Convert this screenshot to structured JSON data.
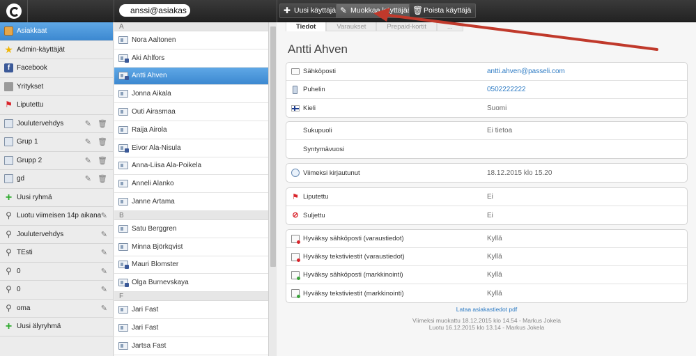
{
  "topbar": {
    "user": "anssi@asiakas",
    "buttons": [
      {
        "label": "Uusi käyttäjä",
        "icon": "plus-icon"
      },
      {
        "label": "Muokkaa käyttäjää",
        "icon": "pencil-icon"
      },
      {
        "label": "Poista käyttäjä",
        "icon": "trash-icon"
      }
    ]
  },
  "sidebar": {
    "items": [
      {
        "label": "Asiakkaat",
        "icon": "address-book-icon"
      },
      {
        "label": "Admin-käyttäjät",
        "icon": "star-icon"
      },
      {
        "label": "Facebook",
        "icon": "facebook-icon"
      },
      {
        "label": "Yritykset",
        "icon": "building-icon"
      },
      {
        "label": "Liputettu",
        "icon": "flag-icon"
      },
      {
        "label": "Joulutervehdys",
        "icon": "group-icon"
      },
      {
        "label": "Grup 1",
        "icon": "group-icon"
      },
      {
        "label": "Grupp 2",
        "icon": "group-icon"
      },
      {
        "label": "gd",
        "icon": "group-icon"
      },
      {
        "label": "Uusi ryhmä",
        "icon": "plus-icon"
      },
      {
        "label": "Luotu viimeisen 14p aikana",
        "icon": "search-icon"
      },
      {
        "label": "Joulutervehdys",
        "icon": "search-icon"
      },
      {
        "label": "TEsti",
        "icon": "search-icon"
      },
      {
        "label": "0",
        "icon": "search-icon"
      },
      {
        "label": "0",
        "icon": "search-icon"
      },
      {
        "label": "oma",
        "icon": "search-icon"
      },
      {
        "label": "Uusi älyryhmä",
        "icon": "plus-icon"
      }
    ]
  },
  "list": {
    "groups": [
      {
        "letter": "A",
        "names": [
          "Nora Aaltonen",
          "Aki Ahlfors",
          "Antti Ahven",
          "Jonna Aikala",
          "Outi Airasmaa",
          "Raija Airola",
          "Eivor Ala-Nisula",
          "Anna-Liisa Ala-Poikela",
          "Anneli Alanko",
          "Janne Artama"
        ]
      },
      {
        "letter": "B",
        "names": [
          "Satu Berggren",
          "Minna Björkqvist",
          "Mauri Blomster",
          "Olga Burnevskaya"
        ]
      },
      {
        "letter": "F",
        "names": [
          "Jari Fast",
          "Jari Fast",
          "Jartsa Fast"
        ]
      }
    ]
  },
  "detail": {
    "tabs": [
      "Tiedot",
      "Varaukset",
      "Prepaid-kortit",
      "..."
    ],
    "name": "Antti Ahven",
    "contact": [
      {
        "label": "Sähköposti",
        "value": "antti.ahven@passeli.com"
      },
      {
        "label": "Puhelin",
        "value": "0502222222"
      },
      {
        "label": "Kieli",
        "value": "Suomi"
      }
    ],
    "personal": [
      {
        "label": "Sukupuoli",
        "value": "Ei tietoa"
      },
      {
        "label": "Syntymävuosi",
        "value": ""
      }
    ],
    "login": {
      "label": "Viimeksi kirjautunut",
      "value": "18.12.2015 klo 15.20"
    },
    "flags": [
      {
        "label": "Liputettu",
        "value": "Ei"
      },
      {
        "label": "Suljettu",
        "value": "Ei"
      }
    ],
    "consents": [
      {
        "label": "Hyväksy sähköposti (varaustiedot)",
        "value": "Kyllä"
      },
      {
        "label": "Hyväksy tekstiviestit (varaustiedot)",
        "value": "Kyllä"
      },
      {
        "label": "Hyväksy sähköposti (markkinointi)",
        "value": "Kyllä"
      },
      {
        "label": "Hyväksy tekstiviestit (markkinointi)",
        "value": "Kyllä"
      }
    ],
    "pdf_link": "Lataa asiakastiedot pdf",
    "modified": "Viimeksi muokattu 18.12.2015 klo 14.54 - Markus Jokela",
    "created": "Luotu 16.12.2015 klo 13.14 - Markus Jokela"
  },
  "colors": {
    "accent": "#3c88d0",
    "arrow": "#c0392b"
  }
}
